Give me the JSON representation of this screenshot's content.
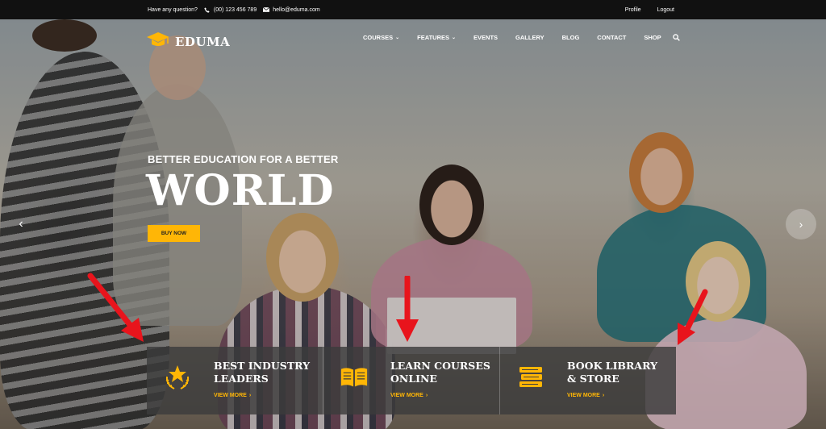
{
  "topbar": {
    "question": "Have any question?",
    "phone": "(00) 123 456 789",
    "email": "hello@eduma.com",
    "profile": "Profile",
    "logout": "Logout"
  },
  "header": {
    "logo_text": "EDUMA",
    "nav": [
      {
        "label": "COURSES",
        "has_dropdown": true
      },
      {
        "label": "FEATURES",
        "has_dropdown": true
      },
      {
        "label": "EVENTS",
        "has_dropdown": false
      },
      {
        "label": "GALLERY",
        "has_dropdown": false
      },
      {
        "label": "BLOG",
        "has_dropdown": false
      },
      {
        "label": "CONTACT",
        "has_dropdown": false
      },
      {
        "label": "SHOP",
        "has_dropdown": false
      }
    ]
  },
  "hero": {
    "subtitle": "BETTER EDUCATION FOR A BETTER",
    "title": "WORLD",
    "button": "BUY NOW"
  },
  "features": [
    {
      "title_line1": "BEST INDUSTRY",
      "title_line2": "LEADERS",
      "link": "VIEW MORE",
      "icon": "award-star-icon"
    },
    {
      "title_line1": "LEARN COURSES",
      "title_line2": "ONLINE",
      "link": "VIEW MORE",
      "icon": "open-book-icon"
    },
    {
      "title_line1": "BOOK LIBRARY",
      "title_line2": "& STORE",
      "link": "VIEW MORE",
      "icon": "book-stack-icon"
    }
  ],
  "colors": {
    "accent": "#ffb606",
    "topbar_bg": "#111111",
    "feature_bg": "#3c3c3c",
    "annotation_red": "#e8141c"
  }
}
